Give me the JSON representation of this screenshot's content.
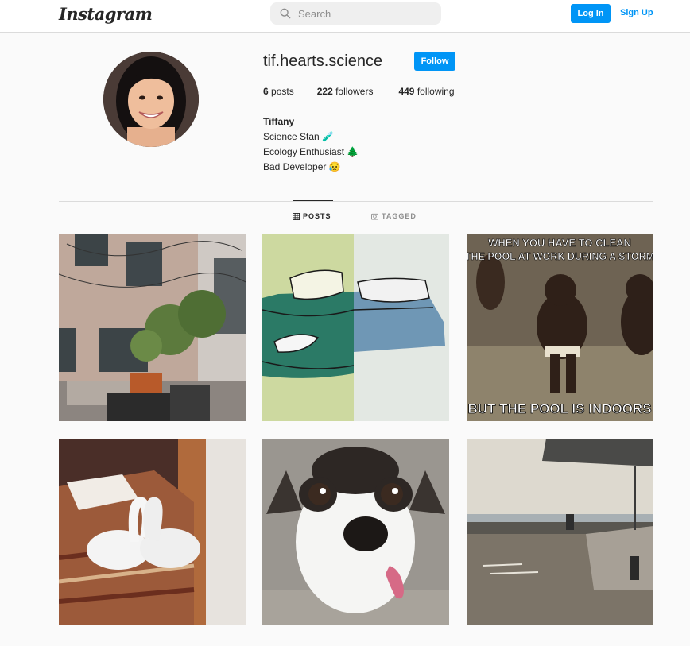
{
  "header": {
    "logo": "Instagram",
    "search_placeholder": "Search",
    "login_label": "Log In",
    "signup_label": "Sign Up"
  },
  "profile": {
    "username": "tif.hearts.science",
    "follow_label": "Follow",
    "posts_count": "6",
    "posts_label": "posts",
    "followers_count": "222",
    "followers_label": "followers",
    "following_count": "449",
    "following_label": "following",
    "full_name": "Tiffany",
    "bio_lines": [
      "Science Stan 🧪",
      "Ecology Enthusiast 🌲",
      "Bad Developer 😥"
    ]
  },
  "tabs": {
    "posts_label": "POSTS",
    "tagged_label": "TAGGED"
  },
  "posts": [
    {
      "name": "courtyard-photo"
    },
    {
      "name": "bed-illustration"
    },
    {
      "name": "meme-photo",
      "caption_top_1": "WHEN YOU HAVE TO CLEAN",
      "caption_top_2": "THE POOL AT WORK DURING A  STORM",
      "caption_bottom": "BUT THE POOL IS INDOORS"
    },
    {
      "name": "towel-swans-photo"
    },
    {
      "name": "dog-photo"
    },
    {
      "name": "waterfront-photo"
    }
  ],
  "colors": {
    "accent": "#0095f6",
    "text": "#262626",
    "muted": "#8e8e8e",
    "border": "#dbdbdb",
    "background": "#fafafa"
  }
}
